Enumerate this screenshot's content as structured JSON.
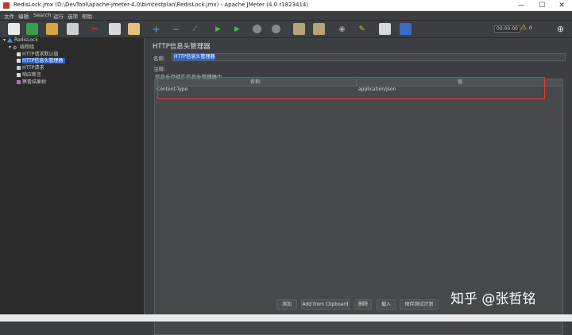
{
  "window": {
    "title": "RedisLock.jmx (D:\\DevTool\\apache-jmeter-4.0\\bin\\testplan\\RedisLock.jmx) - Apache JMeter (4.0 r1823414)",
    "minimize": "—",
    "maximize": "☐",
    "close": "✕"
  },
  "menu": [
    "文件",
    "编辑",
    "Search",
    "运行",
    "选项",
    "帮助"
  ],
  "toolbar": {
    "timer": "00:00:00",
    "warning_count": "0",
    "warning_icon": "⚠",
    "globe_icon": "⊕",
    "plus": "+",
    "minus": "−"
  },
  "tree": {
    "test_plan": "RedisLock",
    "thread_group": "线程组",
    "items": [
      "HTTP请求默认值",
      "HTTP信息头管理器",
      "HTTP请求",
      "响应断言",
      "察看结果树"
    ]
  },
  "panel": {
    "title": "HTTP信息头管理器",
    "name_label": "名称:",
    "name_value": "HTTP信息头管理器",
    "comment_label": "注释:",
    "store_label": "信息头存储在信息头管理器中",
    "columns": [
      "名称:",
      "值"
    ],
    "rows": [
      {
        "name": "Content-Type",
        "value": "application/json"
      }
    ]
  },
  "buttons": [
    "添加",
    "Add from Clipboard",
    "删除",
    "载入",
    "保存测试计划"
  ],
  "watermark": "知乎 @张哲铭",
  "colors": {
    "accent": "#2f65ca",
    "highlight": "#e53935"
  }
}
